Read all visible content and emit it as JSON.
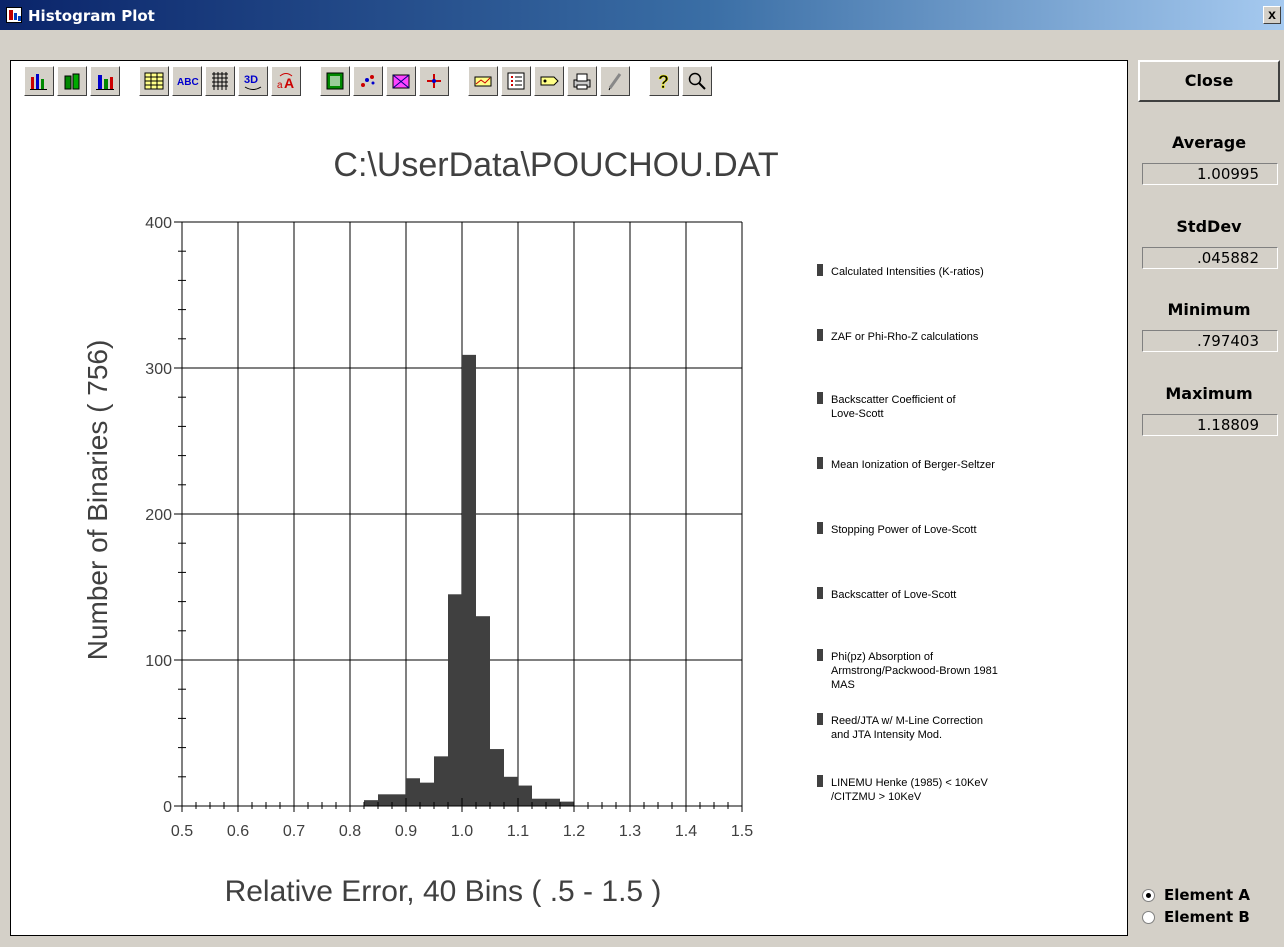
{
  "window": {
    "title": "Histogram Plot",
    "close_glyph": "x"
  },
  "toolbar": [
    {
      "name": "bar-chart-icon"
    },
    {
      "name": "3d-bar-icon"
    },
    {
      "name": "stacked-bar-icon"
    },
    {
      "name": "table-icon"
    },
    {
      "name": "text-abc-icon"
    },
    {
      "name": "grid-icon"
    },
    {
      "name": "rotate-3d-icon"
    },
    {
      "name": "font-icon"
    },
    {
      "name": "background-color-icon"
    },
    {
      "name": "scatter-icon"
    },
    {
      "name": "pattern-icon"
    },
    {
      "name": "crosshair-icon"
    },
    {
      "name": "chart-properties-icon"
    },
    {
      "name": "legend-icon"
    },
    {
      "name": "label-tag-icon"
    },
    {
      "name": "print-icon"
    },
    {
      "name": "edit-pen-icon"
    },
    {
      "name": "help-icon"
    },
    {
      "name": "zoom-icon"
    }
  ],
  "panel": {
    "close_label": "Close",
    "stats": [
      {
        "label": "Average",
        "value": "1.00995"
      },
      {
        "label": "StdDev",
        "value": ".045882"
      },
      {
        "label": "Minimum",
        "value": ".797403"
      },
      {
        "label": "Maximum",
        "value": "1.18809"
      }
    ],
    "radios": [
      {
        "label": "Element A",
        "checked": true
      },
      {
        "label": "Element B",
        "checked": false
      }
    ]
  },
  "chart_data": {
    "type": "bar",
    "title": "C:\\UserData\\POUCHOU.DAT",
    "xlabel": "Relative Error,  40 Bins ( .5 -  1.5 )",
    "ylabel": "Number of Binaries ( 756)",
    "xlim": [
      0.5,
      1.5
    ],
    "ylim": [
      0,
      400
    ],
    "xticks": [
      "0.5",
      "0.6",
      "0.7",
      "0.8",
      "0.9",
      "1.0",
      "1.1",
      "1.2",
      "1.3",
      "1.4",
      "1.5"
    ],
    "yticks": [
      "0",
      "100",
      "200",
      "300",
      "400"
    ],
    "grid": true,
    "bin_width": 0.025,
    "bins_start": [
      0.825,
      0.85,
      0.875,
      0.9,
      0.925,
      0.95,
      0.975,
      1.0,
      1.025,
      1.05,
      1.075,
      1.1,
      1.125,
      1.15,
      1.175
    ],
    "values": [
      4,
      8,
      8,
      19,
      16,
      34,
      145,
      309,
      130,
      39,
      20,
      14,
      5,
      5,
      3
    ],
    "legend": [
      "Calculated Intensities (K-ratios)",
      "ZAF or Phi-Rho-Z calculations",
      "Backscatter Coefficient of Love-Scott",
      "Mean Ionization of Berger-Seltzer",
      "Stopping Power of Love-Scott",
      "Backscatter of Love-Scott",
      "Phi(pz) Absorption of Armstrong/Packwood-Brown 1981 MAS",
      "Reed/JTA w/ M-Line Correction and JTA Intensity Mod.",
      "LINEMU   Henke (1985) < 10KeV /CITZMU > 10KeV"
    ],
    "bar_color": "#404040"
  }
}
